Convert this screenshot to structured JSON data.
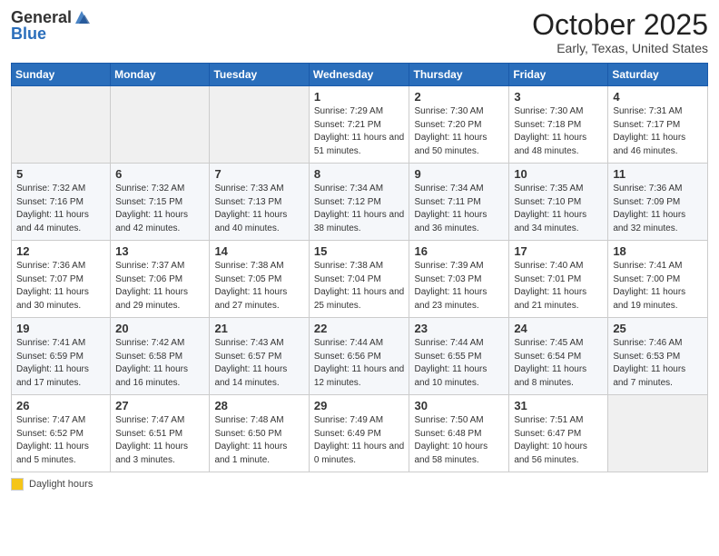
{
  "header": {
    "logo_general": "General",
    "logo_blue": "Blue",
    "month": "October 2025",
    "location": "Early, Texas, United States"
  },
  "legend": {
    "label": "Daylight hours"
  },
  "weekdays": [
    "Sunday",
    "Monday",
    "Tuesday",
    "Wednesday",
    "Thursday",
    "Friday",
    "Saturday"
  ],
  "weeks": [
    [
      {
        "day": "",
        "empty": true
      },
      {
        "day": "",
        "empty": true
      },
      {
        "day": "",
        "empty": true
      },
      {
        "day": "1",
        "sunrise": "7:29 AM",
        "sunset": "7:21 PM",
        "daylight": "11 hours and 51 minutes."
      },
      {
        "day": "2",
        "sunrise": "7:30 AM",
        "sunset": "7:20 PM",
        "daylight": "11 hours and 50 minutes."
      },
      {
        "day": "3",
        "sunrise": "7:30 AM",
        "sunset": "7:18 PM",
        "daylight": "11 hours and 48 minutes."
      },
      {
        "day": "4",
        "sunrise": "7:31 AM",
        "sunset": "7:17 PM",
        "daylight": "11 hours and 46 minutes."
      }
    ],
    [
      {
        "day": "5",
        "sunrise": "7:32 AM",
        "sunset": "7:16 PM",
        "daylight": "11 hours and 44 minutes."
      },
      {
        "day": "6",
        "sunrise": "7:32 AM",
        "sunset": "7:15 PM",
        "daylight": "11 hours and 42 minutes."
      },
      {
        "day": "7",
        "sunrise": "7:33 AM",
        "sunset": "7:13 PM",
        "daylight": "11 hours and 40 minutes."
      },
      {
        "day": "8",
        "sunrise": "7:34 AM",
        "sunset": "7:12 PM",
        "daylight": "11 hours and 38 minutes."
      },
      {
        "day": "9",
        "sunrise": "7:34 AM",
        "sunset": "7:11 PM",
        "daylight": "11 hours and 36 minutes."
      },
      {
        "day": "10",
        "sunrise": "7:35 AM",
        "sunset": "7:10 PM",
        "daylight": "11 hours and 34 minutes."
      },
      {
        "day": "11",
        "sunrise": "7:36 AM",
        "sunset": "7:09 PM",
        "daylight": "11 hours and 32 minutes."
      }
    ],
    [
      {
        "day": "12",
        "sunrise": "7:36 AM",
        "sunset": "7:07 PM",
        "daylight": "11 hours and 30 minutes."
      },
      {
        "day": "13",
        "sunrise": "7:37 AM",
        "sunset": "7:06 PM",
        "daylight": "11 hours and 29 minutes."
      },
      {
        "day": "14",
        "sunrise": "7:38 AM",
        "sunset": "7:05 PM",
        "daylight": "11 hours and 27 minutes."
      },
      {
        "day": "15",
        "sunrise": "7:38 AM",
        "sunset": "7:04 PM",
        "daylight": "11 hours and 25 minutes."
      },
      {
        "day": "16",
        "sunrise": "7:39 AM",
        "sunset": "7:03 PM",
        "daylight": "11 hours and 23 minutes."
      },
      {
        "day": "17",
        "sunrise": "7:40 AM",
        "sunset": "7:01 PM",
        "daylight": "11 hours and 21 minutes."
      },
      {
        "day": "18",
        "sunrise": "7:41 AM",
        "sunset": "7:00 PM",
        "daylight": "11 hours and 19 minutes."
      }
    ],
    [
      {
        "day": "19",
        "sunrise": "7:41 AM",
        "sunset": "6:59 PM",
        "daylight": "11 hours and 17 minutes."
      },
      {
        "day": "20",
        "sunrise": "7:42 AM",
        "sunset": "6:58 PM",
        "daylight": "11 hours and 16 minutes."
      },
      {
        "day": "21",
        "sunrise": "7:43 AM",
        "sunset": "6:57 PM",
        "daylight": "11 hours and 14 minutes."
      },
      {
        "day": "22",
        "sunrise": "7:44 AM",
        "sunset": "6:56 PM",
        "daylight": "11 hours and 12 minutes."
      },
      {
        "day": "23",
        "sunrise": "7:44 AM",
        "sunset": "6:55 PM",
        "daylight": "11 hours and 10 minutes."
      },
      {
        "day": "24",
        "sunrise": "7:45 AM",
        "sunset": "6:54 PM",
        "daylight": "11 hours and 8 minutes."
      },
      {
        "day": "25",
        "sunrise": "7:46 AM",
        "sunset": "6:53 PM",
        "daylight": "11 hours and 7 minutes."
      }
    ],
    [
      {
        "day": "26",
        "sunrise": "7:47 AM",
        "sunset": "6:52 PM",
        "daylight": "11 hours and 5 minutes."
      },
      {
        "day": "27",
        "sunrise": "7:47 AM",
        "sunset": "6:51 PM",
        "daylight": "11 hours and 3 minutes."
      },
      {
        "day": "28",
        "sunrise": "7:48 AM",
        "sunset": "6:50 PM",
        "daylight": "11 hours and 1 minute."
      },
      {
        "day": "29",
        "sunrise": "7:49 AM",
        "sunset": "6:49 PM",
        "daylight": "11 hours and 0 minutes."
      },
      {
        "day": "30",
        "sunrise": "7:50 AM",
        "sunset": "6:48 PM",
        "daylight": "10 hours and 58 minutes."
      },
      {
        "day": "31",
        "sunrise": "7:51 AM",
        "sunset": "6:47 PM",
        "daylight": "10 hours and 56 minutes."
      },
      {
        "day": "",
        "empty": true
      }
    ]
  ]
}
